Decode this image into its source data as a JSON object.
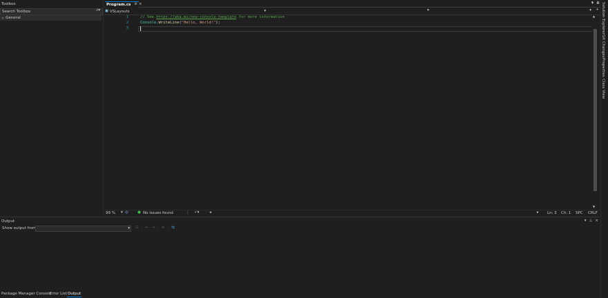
{
  "toolbox": {
    "title": "Toolbox",
    "search_placeholder": "Search Toolbox",
    "group": "General",
    "pin_glyph": "⊼",
    "close_glyph": "×"
  },
  "editor": {
    "tab_label": "Program.cs",
    "tab_pin": "⊕",
    "tab_close": "×",
    "nav_project": "VSLayouts",
    "lines": [
      {
        "num": "1",
        "tokens": [
          {
            "t": "// See ",
            "c": "#57a64a"
          },
          {
            "t": "https://aka.ms/new-console-template",
            "c": "#57a64a",
            "u": true
          },
          {
            "t": " for more information",
            "c": "#57a64a"
          }
        ]
      },
      {
        "num": "2",
        "tokens": [
          {
            "t": "Console",
            "c": "#4ec9b0"
          },
          {
            "t": ".",
            "c": "#dcdcdc"
          },
          {
            "t": "WriteLine",
            "c": "#dcdcaa"
          },
          {
            "t": "(",
            "c": "#dcdcdc"
          },
          {
            "t": "\"Hello, World!\"",
            "c": "#d69d85"
          },
          {
            "t": ");",
            "c": "#dcdcdc"
          }
        ]
      },
      {
        "num": "3",
        "tokens": []
      }
    ]
  },
  "editor_status": {
    "zoom": "99 %",
    "issues": "No issues found",
    "ln": "Ln: 3",
    "ch": "Ch: 1",
    "spc": "SPC",
    "crlf": "CRLF"
  },
  "right_rail": [
    "Solution Explorer",
    "Git Changes",
    "Properties",
    "Class View"
  ],
  "output": {
    "title": "Output",
    "show_from_label": "Show output from:",
    "show_from_value": ""
  },
  "bottom_tabs": [
    "Package Manager Console",
    "Error List",
    "Output"
  ],
  "colors": {
    "accent": "#007acc",
    "background": "#1f1f1f",
    "issues_ok": "#3fb950"
  }
}
